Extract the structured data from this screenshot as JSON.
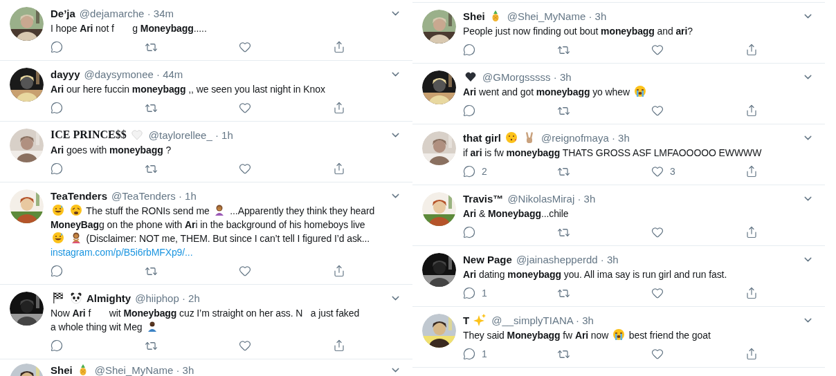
{
  "columns": [
    {
      "tweets": [
        {
          "name": [
            {
              "kind": "text",
              "text": "De’ja"
            }
          ],
          "meta": "@dejamarche · 34m",
          "body": [
            {
              "kind": "text",
              "text": "I hope **Ari** not f       g **Moneybagg**....."
            }
          ]
        },
        {
          "name": [
            {
              "kind": "text",
              "text": "dayyy"
            }
          ],
          "meta": "@daysymonee · 44m",
          "body": [
            {
              "kind": "text",
              "text": "**Ari** our here fuccin **moneybagg** ,, we seen you last night in Knox"
            }
          ]
        },
        {
          "name": [
            {
              "kind": "serif-text",
              "text": "ICE PRINCE$$"
            },
            {
              "kind": "white-heart"
            }
          ],
          "meta": "@taylorellee_ · 1h",
          "body": [
            {
              "kind": "text",
              "text": "**Ari** goes with **moneybagg** ?"
            }
          ]
        },
        {
          "name": [
            {
              "kind": "text",
              "text": "TeaTenders"
            }
          ],
          "meta": "@TeaTenders · 1h",
          "body": [
            {
              "kind": "sweat-smile"
            },
            {
              "kind": "weary"
            },
            {
              "kind": "text",
              "text": "The stuff the RONIs send me"
            },
            {
              "kind": "facepalm-woman"
            },
            {
              "kind": "text",
              "text": "...Apparently they think they heard"
            },
            {
              "kind": "text",
              "text": "**MoneyBag**g on the phone with **Ar**i in the background of his homeboys live"
            },
            {
              "kind": "sweat-smile"
            },
            {
              "kind": "no-woman"
            },
            {
              "kind": "text",
              "text": "(Disclaimer: NOT me, THEM. But since I can’t tell I figured I’d ask..."
            },
            {
              "kind": "link",
              "text": "instagram.com/p/B5i6rbMFXp9/..."
            }
          ]
        },
        {
          "name": [
            {
              "kind": "chequered-flag"
            },
            {
              "kind": "panda"
            },
            {
              "kind": "text",
              "text": "Almighty"
            }
          ],
          "meta": "@hiiphop · 2h",
          "body": [
            {
              "kind": "text",
              "text": "Now **Ari** f       wit **Moneybagg** cuz I’m straight on her ass. N   a just faked"
            },
            {
              "kind": "text",
              "text": "a whole thing wit Meg"
            },
            {
              "kind": "facepalm-man"
            }
          ]
        },
        {
          "name": [
            {
              "kind": "text",
              "text": "Shei"
            },
            {
              "kind": "pineapple"
            }
          ],
          "meta": "@Shei_MyName · 3h"
        }
      ]
    },
    {
      "tweets": [
        {
          "name": [
            {
              "kind": "text",
              "text": "Shei"
            },
            {
              "kind": "pineapple"
            }
          ],
          "meta": "@Shei_MyName · 3h",
          "body": [
            {
              "kind": "text",
              "text": "People just now finding out bout **moneybagg** and **ari**?"
            }
          ]
        },
        {
          "name": [
            {
              "kind": "black-heart"
            }
          ],
          "meta": "@GMorgsssss · 3h",
          "body": [
            {
              "kind": "text",
              "text": "**Ari** went and got **moneybagg** yo whew"
            },
            {
              "kind": "crying"
            }
          ]
        },
        {
          "name": [
            {
              "kind": "text",
              "text": "that girl"
            },
            {
              "kind": "kiss-wink"
            },
            {
              "kind": "victory-hand"
            }
          ],
          "meta": "@reignofmaya · 3h",
          "body": [
            {
              "kind": "text",
              "text": "if **ari** is fw **moneybagg** THATS GROSS ASF LMFAOOOOO EWWWW"
            }
          ],
          "reply_count": "2",
          "like_count": "3"
        },
        {
          "name": [
            {
              "kind": "text",
              "text": "Travis™"
            }
          ],
          "meta": "@NikolasMiraj · 3h",
          "body": [
            {
              "kind": "text",
              "text": "**Ari** & **Moneybagg**...chile"
            }
          ]
        },
        {
          "name": [
            {
              "kind": "text",
              "text": "New Page"
            }
          ],
          "meta": "@jainashepperdd · 3h",
          "body": [
            {
              "kind": "text",
              "text": "**Ari** dating **moneybagg** you. All ima say is run girl and run fast."
            }
          ],
          "reply_count": "1"
        },
        {
          "name": [
            {
              "kind": "text",
              "text": "T"
            },
            {
              "kind": "sparkles"
            }
          ],
          "meta": "@__simplyTIANA · 3h",
          "body": [
            {
              "kind": "text",
              "text": "They said **Moneybagg** fw **Ari** now"
            },
            {
              "kind": "crying"
            },
            {
              "kind": "text",
              "text": "best friend the goat"
            }
          ],
          "reply_count": "1"
        }
      ]
    }
  ]
}
